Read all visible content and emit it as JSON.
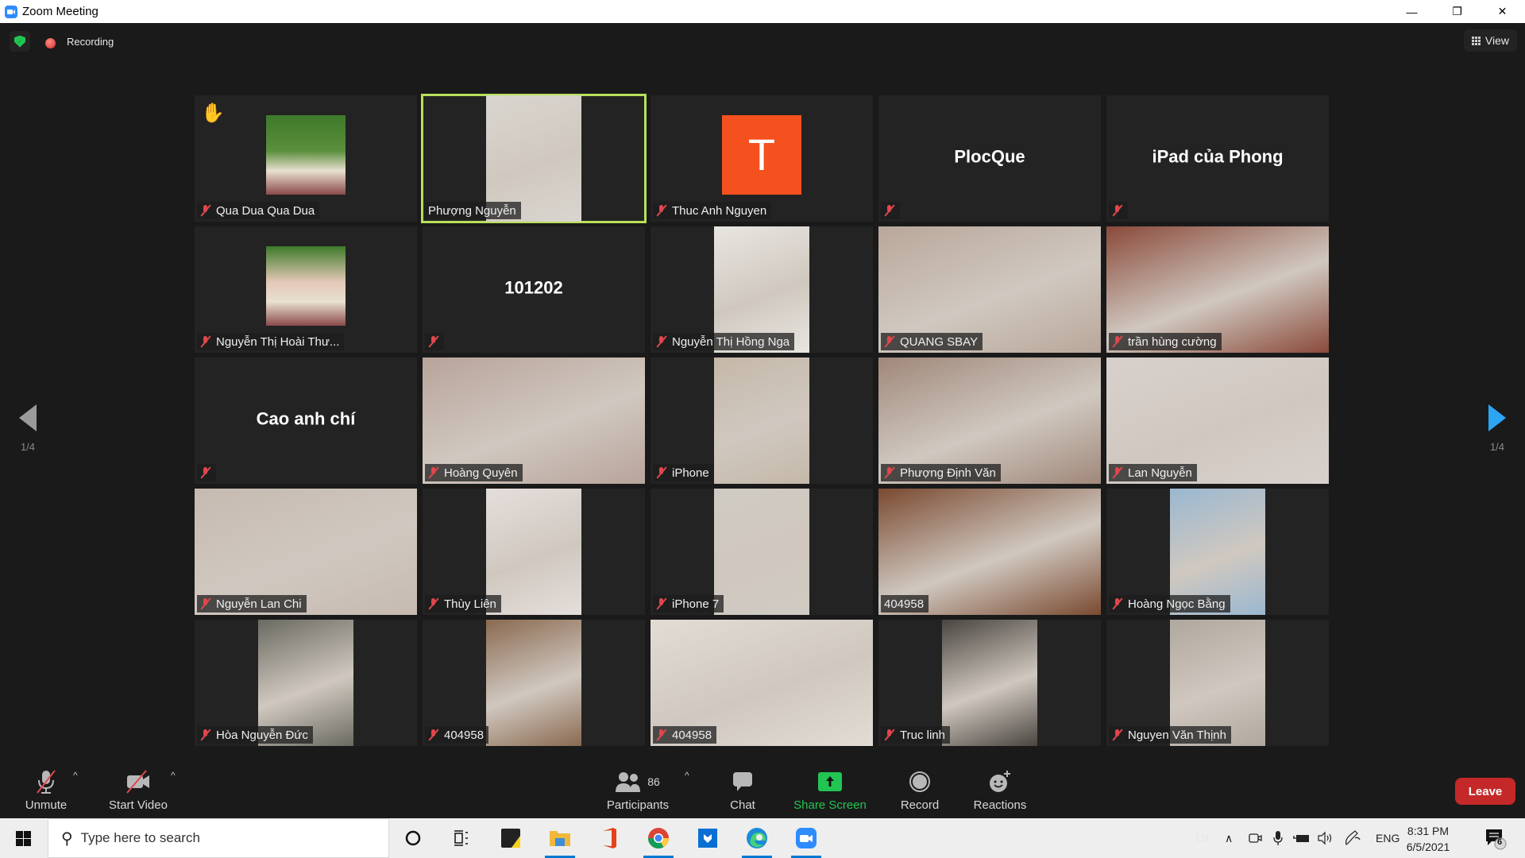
{
  "window": {
    "title": "Zoom Meeting",
    "controls": [
      "minimize",
      "restore",
      "close"
    ]
  },
  "topbar": {
    "security_icon": "shield-check-icon",
    "recording_label": "Recording",
    "view_label": "View"
  },
  "pagination": {
    "left_page": "1/4",
    "right_page": "1/4"
  },
  "participants": [
    {
      "name": "Qua Dua Qua Dua",
      "muted": true,
      "hand_raised": true,
      "mode": "avatar",
      "avatar_color": "#5b8f3c"
    },
    {
      "name": "Phượng Nguyễn",
      "muted": false,
      "active_speaker": true,
      "mode": "video",
      "video_color": "#d9d6cf"
    },
    {
      "name": "Thuc Anh Nguyen",
      "muted": true,
      "mode": "letter",
      "letter": "T",
      "letter_color": "#f4511e"
    },
    {
      "name": "",
      "display_name": "PlocQue",
      "muted": true,
      "mode": "name"
    },
    {
      "name": "",
      "display_name": "iPad của Phong",
      "muted": true,
      "mode": "name"
    },
    {
      "name": "Nguyễn Thị Hoài Thư...",
      "muted": true,
      "mode": "avatar",
      "avatar_color": "#e4c8b8"
    },
    {
      "name": "",
      "display_name": "101202",
      "muted": true,
      "mode": "name"
    },
    {
      "name": "Nguyễn Thị Hồng Nga",
      "muted": true,
      "mode": "video",
      "video_color": "#e8e6e0"
    },
    {
      "name": "QUANG SBAY",
      "muted": true,
      "mode": "video-full",
      "video_color": "#b9a79a"
    },
    {
      "name": "trần hùng cường",
      "muted": true,
      "mode": "video-full",
      "video_color": "#8a4a3a"
    },
    {
      "name": "",
      "display_name": "Cao anh chí",
      "muted": true,
      "mode": "name"
    },
    {
      "name": "Hoàng Quyên",
      "muted": true,
      "mode": "video-full",
      "video_color": "#b8a49a"
    },
    {
      "name": "iPhone",
      "muted": true,
      "mode": "video",
      "video_color": "#c4b8a8"
    },
    {
      "name": "Phượng Định Văn",
      "muted": true,
      "mode": "video-full",
      "video_color": "#a0887a"
    },
    {
      "name": "Lan Nguyễn",
      "muted": true,
      "mode": "video-full",
      "video_color": "#d8d0cc"
    },
    {
      "name": "Nguyễn Lan Chi",
      "muted": true,
      "mode": "video-full",
      "video_color": "#c6bab0"
    },
    {
      "name": "Thùy Liên",
      "muted": true,
      "mode": "video",
      "video_color": "#e4dedb"
    },
    {
      "name": "iPhone 7",
      "muted": true,
      "mode": "video",
      "video_color": "#cfcac2"
    },
    {
      "name": "404958",
      "muted": false,
      "mode": "video-full",
      "video_color": "#7a4a30"
    },
    {
      "name": "Hoàng Ngọc Bằng",
      "muted": true,
      "mode": "video",
      "video_color": "#9ab8d0"
    },
    {
      "name": "Hòa Nguyễn Đức",
      "muted": true,
      "mode": "video",
      "video_color": "#6a6a60"
    },
    {
      "name": "404958",
      "muted": true,
      "mode": "video",
      "video_color": "#8a6a50"
    },
    {
      "name": "404958",
      "muted": true,
      "mode": "video-full",
      "video_color": "#e2dcd4"
    },
    {
      "name": "Truc linh",
      "muted": true,
      "mode": "video",
      "video_color": "#4a4540"
    },
    {
      "name": "Nguyen Văn Thịnh",
      "muted": true,
      "mode": "video",
      "video_color": "#b0a89e"
    }
  ],
  "toolbar": {
    "unmute_label": "Unmute",
    "start_video_label": "Start Video",
    "participants_label": "Participants",
    "participants_count": "86",
    "chat_label": "Chat",
    "share_screen_label": "Share Screen",
    "record_label": "Record",
    "reactions_label": "Reactions",
    "leave_label": "Leave",
    "share_color": "#23c552",
    "leave_color": "#c52828"
  },
  "taskbar": {
    "search_placeholder": "Type here to search",
    "apps": [
      "cortana",
      "task-view",
      "sticky-notes",
      "file-explorer",
      "office",
      "chrome",
      "store-app",
      "edge",
      "zoom"
    ],
    "running": [
      "file-explorer",
      "chrome",
      "edge",
      "zoom"
    ],
    "input_indicator": "EN",
    "language": "ENG",
    "time": "8:31 PM",
    "date": "6/5/2021",
    "notification_count": "6"
  }
}
